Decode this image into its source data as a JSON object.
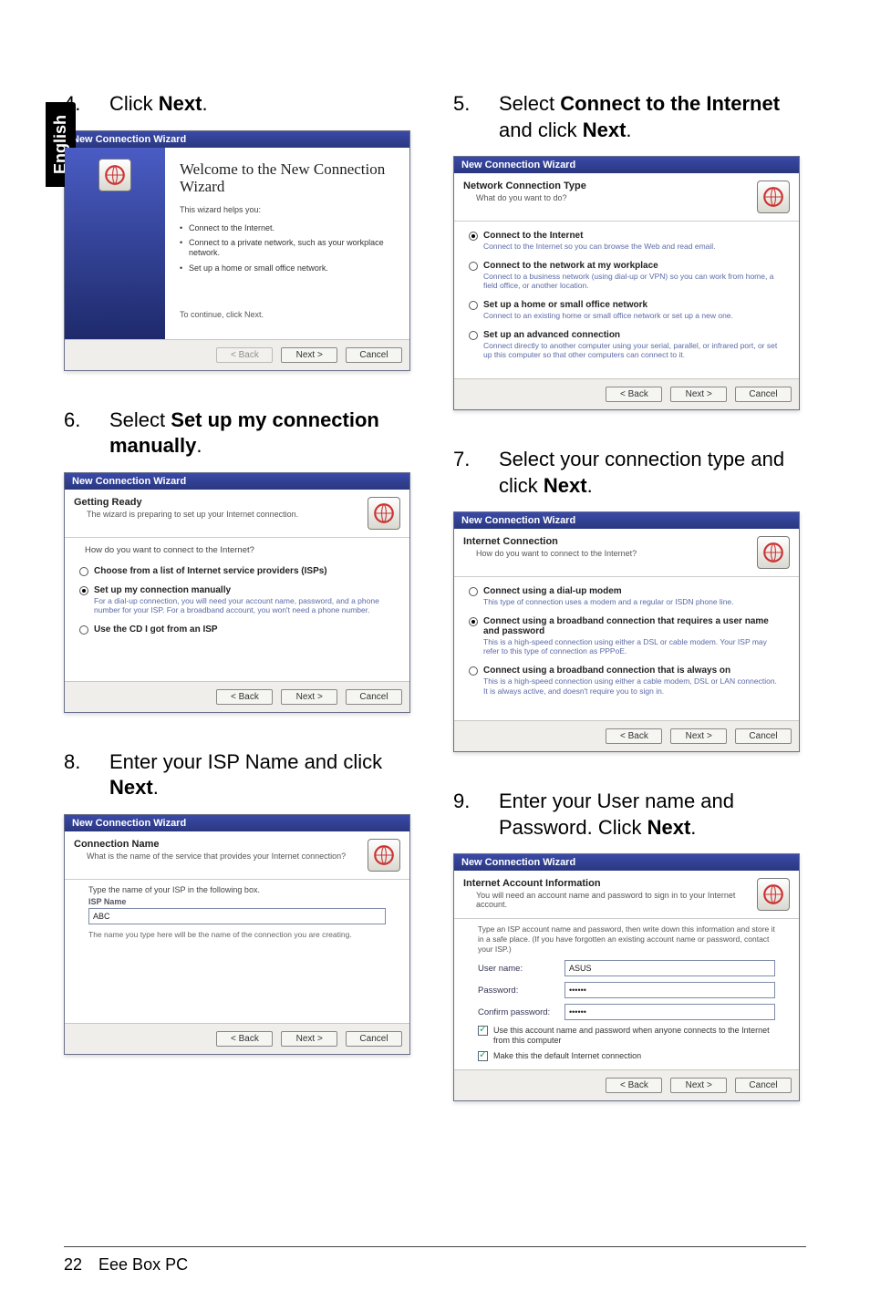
{
  "lang_tab": "English",
  "footer": {
    "page": "22",
    "book": "Eee Box PC"
  },
  "wiz_common": {
    "title": "New Connection Wizard",
    "back": "< Back",
    "next": "Next >",
    "cancel": "Cancel"
  },
  "steps": {
    "s4": {
      "num": "4.",
      "text_pre": "Click ",
      "text_b": "Next",
      "text_post": ".",
      "heading": "Welcome to the New Connection Wizard",
      "sub": "This wizard helps you:",
      "b1": "Connect to the Internet.",
      "b2": "Connect to a private network, such as your workplace network.",
      "b3": "Set up a home or small office network.",
      "cont": "To continue, click Next."
    },
    "s5": {
      "num": "5.",
      "text_pre": "Select ",
      "text_b1": "Connect to the Internet",
      "text_mid": " and click ",
      "text_b2": "Next",
      "text_post": ".",
      "hdr_t": "Network Connection Type",
      "hdr_s": "What do you want to do?",
      "o1_t": "Connect to the Internet",
      "o1_d": "Connect to the Internet so you can browse the Web and read email.",
      "o2_t": "Connect to the network at my workplace",
      "o2_d": "Connect to a business network (using dial-up or VPN) so you can work from home, a field office, or another location.",
      "o3_t": "Set up a home or small office network",
      "o3_d": "Connect to an existing home or small office network or set up a new one.",
      "o4_t": "Set up an advanced connection",
      "o4_d": "Connect directly to another computer using your serial, parallel, or infrared port, or set up this computer so that other computers can connect to it."
    },
    "s6": {
      "num": "6.",
      "text_pre": "Select ",
      "text_b": "Set up my connection manually",
      "text_post": ".",
      "hdr_t": "Getting Ready",
      "hdr_s": "The wizard is preparing to set up your Internet connection.",
      "prompt": "How do you want to connect to the Internet?",
      "o1_t": "Choose from a list of Internet service providers (ISPs)",
      "o2_t": "Set up my connection manually",
      "o2_d": "For a dial-up connection, you will need your account name, password, and a phone number for your ISP. For a broadband account, you won't need a phone number.",
      "o3_t": "Use the CD I got from an ISP"
    },
    "s7": {
      "num": "7.",
      "text_pre": "Select your connection type and click ",
      "text_b": "Next",
      "text_post": ".",
      "hdr_t": "Internet Connection",
      "hdr_s": "How do you want to connect to the Internet?",
      "o1_t": "Connect using a dial-up modem",
      "o1_d": "This type of connection uses a modem and a regular or ISDN phone line.",
      "o2_t": "Connect using a broadband connection that requires a user name and password",
      "o2_d": "This is a high-speed connection using either a DSL or cable modem. Your ISP may refer to this type of connection as PPPoE.",
      "o3_t": "Connect using a broadband connection that is always on",
      "o3_d": "This is a high-speed connection using either a cable modem, DSL or LAN connection. It is always active, and doesn't require you to sign in."
    },
    "s8": {
      "num": "8.",
      "text_pre": "Enter your ISP Name and click ",
      "text_b": "Next",
      "text_post": ".",
      "hdr_t": "Connection Name",
      "hdr_s": "What is the name of the service that provides your Internet connection?",
      "label": "Type the name of your ISP in the following box.",
      "isp_lbl": "ISP Name",
      "isp_val": "ABC",
      "hint": "The name you type here will be the name of the connection you are creating."
    },
    "s9": {
      "num": "9.",
      "text_pre": "Enter your User name and Password. Click ",
      "text_b": "Next",
      "text_post": ".",
      "hdr_t": "Internet Account Information",
      "hdr_s": "You will need an account name and password to sign in to your Internet account.",
      "note": "Type an ISP account name and password, then write down this information and store it in a safe place. (If you have forgotten an existing account name or password, contact your ISP.)",
      "user_l": "User name:",
      "user_v": "ASUS",
      "pass_l": "Password:",
      "pass_v": "••••••",
      "conf_l": "Confirm password:",
      "conf_v": "••••••",
      "chk1": "Use this account name and password when anyone connects to the Internet from this computer",
      "chk2": "Make this the default Internet connection"
    }
  }
}
